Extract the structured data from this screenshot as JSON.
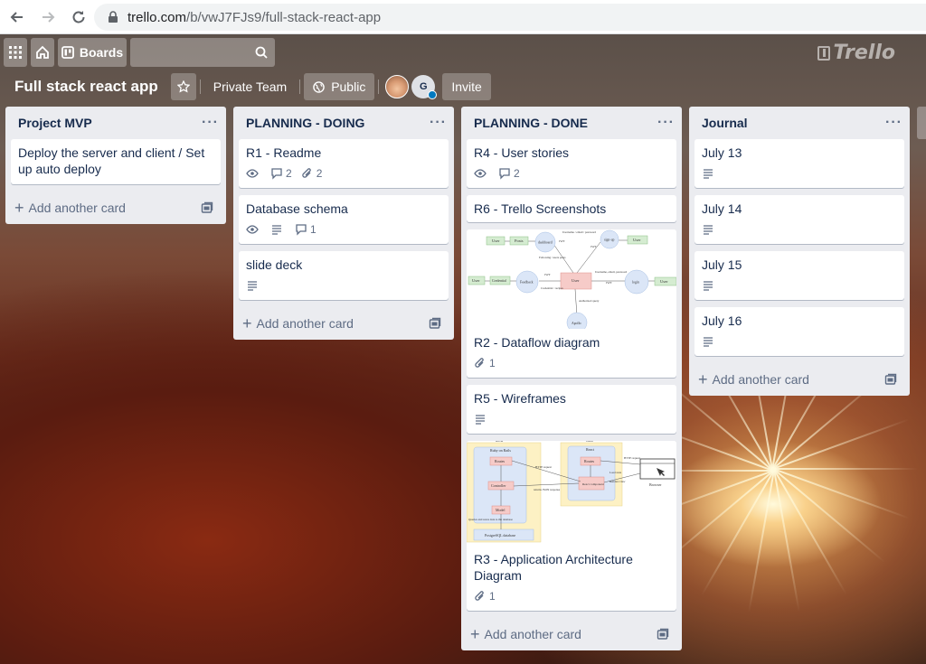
{
  "browser": {
    "url_host": "trello.com",
    "url_path": "/b/vwJ7FJs9/full-stack-react-app"
  },
  "topbar": {
    "boards_label": "Boards",
    "logo_text": "Trello"
  },
  "board": {
    "title": "Full stack react app",
    "team_label": "Private Team",
    "visibility_label": "Public",
    "invite_label": "Invite",
    "avatar_initial": "G"
  },
  "add_card_label": "Add another card",
  "lists": [
    {
      "title": "Project MVP",
      "cards": [
        {
          "title": "Deploy the server and client / Set up auto deploy"
        }
      ]
    },
    {
      "title": "PLANNING - DOING",
      "cards": [
        {
          "title": "R1 - Readme",
          "comments": "2",
          "attachments": "2"
        },
        {
          "title": "Database schema",
          "comments": "1"
        },
        {
          "title": "slide deck"
        }
      ]
    },
    {
      "title": "PLANNING - DONE",
      "cards": [
        {
          "title": "R4 - User stories",
          "comments": "2"
        },
        {
          "title": "R6 - Trello Screenshots"
        },
        {
          "title": "R2 - Dataflow diagram",
          "attachments": "1"
        },
        {
          "title": "R5 - Wireframes"
        },
        {
          "title": "R3 - Application Architecture Diagram",
          "attachments": "1"
        }
      ]
    },
    {
      "title": "Journal",
      "cards": [
        {
          "title": "July 13"
        },
        {
          "title": "July 14"
        },
        {
          "title": "July 15"
        },
        {
          "title": "July 16"
        }
      ]
    }
  ],
  "dataflow_diagram": {
    "nodes": [
      "User",
      "Posts",
      "dashboard",
      "sign-up",
      "User",
      "User",
      "Credential",
      "Feedback",
      "User",
      "login",
      "User",
      "Apollo"
    ],
    "edge_labels": [
      "JWT",
      "JWT",
      "Username / email / password",
      "Following / users posts",
      "Credential / recipes",
      "Username, email, password",
      "JWT",
      "JWT",
      "Authorized query"
    ]
  },
  "architecture_diagram": {
    "server_box": "Ruby on Rails",
    "client_box": "React",
    "server_section": "server",
    "client_section": "client",
    "nodes": [
      "Routes",
      "Controller",
      "Model",
      "PostgreSQL database",
      "Routes",
      "React component",
      "Browser"
    ],
    "edge_labels": [
      "HTTP request",
      "returns JSON response",
      "Queries and saves data to the database",
      "HTTP request",
      "Load state",
      "Renders view"
    ]
  }
}
